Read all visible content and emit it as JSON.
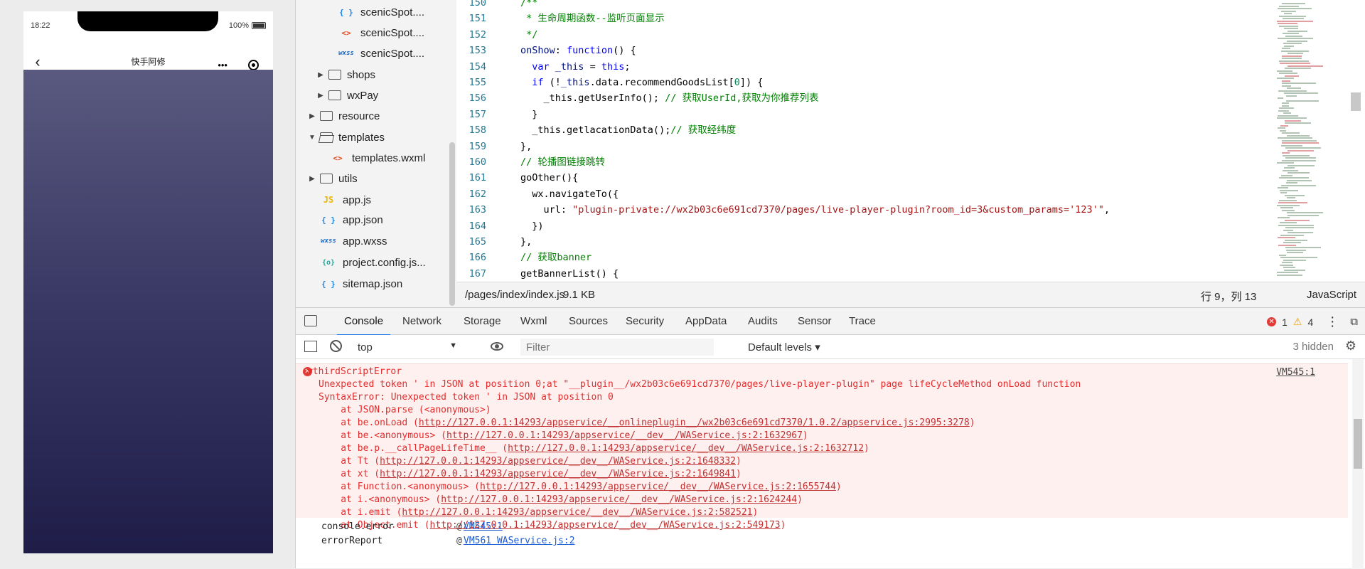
{
  "simulator": {
    "time": "18:22",
    "battery": "100%",
    "title": "快手阿修",
    "back_icon": "chevron-left-icon",
    "more_label": "•••",
    "gradient_top": "#5a597f",
    "gradient_bottom": "#1f1c48"
  },
  "explorer": {
    "items": [
      {
        "label": "scenicSpot....",
        "icon": "{ }",
        "kind": "json"
      },
      {
        "label": "scenicSpot....",
        "icon": "<>",
        "kind": "wxml"
      },
      {
        "label": "scenicSpot....",
        "icon": "wxss",
        "kind": "wxss"
      },
      {
        "label": "shops",
        "icon": "folder",
        "kind": "folder"
      },
      {
        "label": "wxPay",
        "icon": "folder",
        "kind": "folder"
      },
      {
        "label": "resource",
        "icon": "folder",
        "kind": "folder"
      },
      {
        "label": "templates",
        "icon": "folder-open",
        "kind": "folder-open"
      },
      {
        "label": "templates.wxml",
        "icon": "<>",
        "kind": "wxml"
      },
      {
        "label": "utils",
        "icon": "folder",
        "kind": "folder"
      },
      {
        "label": "app.js",
        "icon": "JS",
        "kind": "js"
      },
      {
        "label": "app.json",
        "icon": "{ }",
        "kind": "json"
      },
      {
        "label": "app.wxss",
        "icon": "wxss",
        "kind": "wxss"
      },
      {
        "label": "project.config.js...",
        "icon": "{o}",
        "kind": "cfg"
      },
      {
        "label": "sitemap.json",
        "icon": "{ }",
        "kind": "json"
      }
    ]
  },
  "editor": {
    "lines": [
      {
        "n": "150",
        "html": "<span class='c-cm'>/**</span>"
      },
      {
        "n": "151",
        "html": "<span class='c-cm'> * 生命周期函数--监听页面显示</span>"
      },
      {
        "n": "152",
        "html": "<span class='c-cm'> */</span>"
      },
      {
        "n": "153",
        "html": "<span class='c-prop'>onShow</span>: <span class='c-kw'>function</span>() {"
      },
      {
        "n": "154",
        "html": "  <span class='c-kw'>var</span> <span class='c-prop'>_this</span> = <span class='c-kw'>this</span>;"
      },
      {
        "n": "155",
        "html": "  <span class='c-kw'>if</span> (!<span class='c-prop'>_this</span>.data.recommendGoodsList[<span class='c-num'>0</span>]) {"
      },
      {
        "n": "156",
        "html": "    _this.getUserInfo(); <span class='c-cm'>// 获取UserId,获取为你推荐列表</span>"
      },
      {
        "n": "157",
        "html": "  }"
      },
      {
        "n": "158",
        "html": "  _this.getlacationData();<span class='c-cm'>// 获取经纬度</span>"
      },
      {
        "n": "159",
        "html": "},"
      },
      {
        "n": "160",
        "html": "<span class='c-cm'>// 轮播图链接跳转</span>"
      },
      {
        "n": "161",
        "html": "goOther(){"
      },
      {
        "n": "162",
        "html": "  wx.navigateTo({"
      },
      {
        "n": "163",
        "html": "    url: <span class='c-str'>\"plugin-private://wx2b03c6e691cd7370/pages/live-player-plugin?room_id=3&amp;custom_params='123'\"</span>,"
      },
      {
        "n": "164",
        "html": "  })"
      },
      {
        "n": "165",
        "html": "},"
      },
      {
        "n": "166",
        "html": "<span class='c-cm'>// 获取banner</span>"
      },
      {
        "n": "167",
        "html": "getBannerList() {"
      }
    ]
  },
  "statusbar": {
    "path": "/pages/index/index.js",
    "size": "9.1 KB",
    "cursor": "行 9，列 13",
    "language": "JavaScript"
  },
  "devtools": {
    "tabs": [
      "Console",
      "Network",
      "Storage",
      "Wxml",
      "Sources",
      "Security",
      "AppData",
      "Audits",
      "Sensor",
      "Trace"
    ],
    "active_tab": "Console",
    "error_count": "1",
    "warn_count": "4",
    "context": "top",
    "filter_placeholder": "Filter",
    "levels": "Default levels",
    "hidden": "3 hidden"
  },
  "console": {
    "error_title": "▼thirdScriptError",
    "source": "VM545:1",
    "messages": [
      "Unexpected token ' in JSON at position 0;at \"__plugin__/wx2b03c6e691cd7370/pages/live-player-plugin\" page lifeCycleMethod onLoad function",
      "SyntaxError: Unexpected token ' in JSON at position 0"
    ],
    "stack": [
      {
        "prefix": "    at JSON.parse (<anonymous>)",
        "url": "",
        "suffix": ""
      },
      {
        "prefix": "    at be.onLoad (",
        "url": "http://127.0.0.1:14293/appservice/__onlineplugin__/wx2b03c6e691cd7370/1.0.2/appservice.js:2995:3278",
        "suffix": ")"
      },
      {
        "prefix": "    at be.<anonymous> (",
        "url": "http://127.0.0.1:14293/appservice/__dev__/WAService.js:2:1632967",
        "suffix": ")"
      },
      {
        "prefix": "    at be.p.__callPageLifeTime__ (",
        "url": "http://127.0.0.1:14293/appservice/__dev__/WAService.js:2:1632712",
        "suffix": ")"
      },
      {
        "prefix": "    at Tt (",
        "url": "http://127.0.0.1:14293/appservice/__dev__/WAService.js:2:1648332",
        "suffix": ")"
      },
      {
        "prefix": "    at xt (",
        "url": "http://127.0.0.1:14293/appservice/__dev__/WAService.js:2:1649841",
        "suffix": ")"
      },
      {
        "prefix": "    at Function.<anonymous> (",
        "url": "http://127.0.0.1:14293/appservice/__dev__/WAService.js:2:1655744",
        "suffix": ")"
      },
      {
        "prefix": "    at i.<anonymous> (",
        "url": "http://127.0.0.1:14293/appservice/__dev__/WAService.js:2:1624244",
        "suffix": ")"
      },
      {
        "prefix": "    at i.emit (",
        "url": "http://127.0.0.1:14293/appservice/__dev__/WAService.js:2:582521",
        "suffix": ")"
      },
      {
        "prefix": "    at Object.emit (",
        "url": "http://127.0.0.1:14293/appservice/__dev__/WAService.js:2:549173",
        "suffix": ")"
      }
    ],
    "trace_rows": [
      {
        "fn": "console.error",
        "at": "@",
        "link": "VM545:1"
      },
      {
        "fn": "errorReport",
        "at": "@",
        "link": "VM561 WAService.js:2"
      }
    ]
  }
}
